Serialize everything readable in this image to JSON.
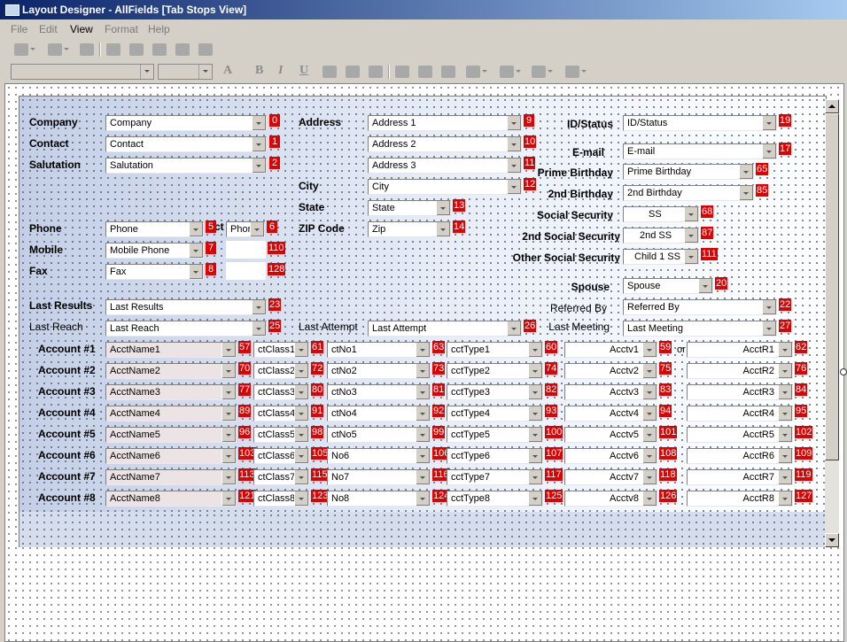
{
  "window": {
    "title": "Layout Designer - AllFields [Tab Stops View]"
  },
  "menu": [
    "File",
    "Edit",
    "View",
    "Format",
    "Help"
  ],
  "labels": {
    "company": "Company",
    "contact": "Contact",
    "salutation": "Salutation",
    "phone": "Phone",
    "phone_ext": "ct",
    "mobile": "Mobile",
    "fax": "Fax",
    "last_results": "Last Results",
    "last_reach": "Last Reach",
    "address": "Address",
    "city": "City",
    "state": "State",
    "zip": "ZIP Code",
    "last_attempt": "Last Attempt",
    "id_status": "ID/Status",
    "email": "E-mail",
    "prime_birthday": "Prime Birthday",
    "second_birthday": "2nd Birthday",
    "ssn": "Social Security",
    "second_ssn": "2nd Social Security",
    "other_ssn": "Other Social Security",
    "spouse": "Spouse",
    "referred_by": "Referred By",
    "last_meeting": "Last Meeting",
    "acct_or": "or"
  },
  "fields": {
    "company": {
      "value": "Company",
      "tab": "0"
    },
    "contact": {
      "value": "Contact",
      "tab": "1"
    },
    "salutation": {
      "value": "Salutation",
      "tab": "2"
    },
    "phone": {
      "value": "Phone",
      "tab": "5"
    },
    "phone_ext": {
      "value": "Phor",
      "tab": "6"
    },
    "mobile": {
      "value": "Mobile Phone",
      "tab": "7"
    },
    "mobile_ext": {
      "tab": "110"
    },
    "fax": {
      "value": "Fax",
      "tab": "8"
    },
    "fax_ext": {
      "tab": "128"
    },
    "last_results": {
      "value": "Last Results",
      "tab": "23"
    },
    "last_reach": {
      "value": "Last Reach",
      "tab": "25"
    },
    "address1": {
      "value": "Address 1",
      "tab": "9"
    },
    "address2": {
      "value": "Address 2",
      "tab": "10"
    },
    "address3": {
      "value": "Address 3",
      "tab": "11"
    },
    "city": {
      "value": "City",
      "tab": "12"
    },
    "state": {
      "value": "State",
      "tab": "13"
    },
    "zip": {
      "value": "Zip",
      "tab": "14"
    },
    "last_attempt": {
      "value": "Last Attempt",
      "tab": "26"
    },
    "id_status": {
      "value": "ID/Status",
      "tab": "19"
    },
    "email": {
      "value": "E-mail",
      "tab": "17"
    },
    "prime_birthday": {
      "value": "Prime Birthday",
      "tab": "65"
    },
    "second_birthday": {
      "value": "2nd Birthday",
      "tab": "85"
    },
    "ssn": {
      "value": "SS",
      "tab": "68"
    },
    "second_ssn": {
      "value": "2nd SS",
      "tab": "87"
    },
    "other_ssn": {
      "value": "Child 1 SS",
      "tab": "111"
    },
    "spouse": {
      "value": "Spouse",
      "tab": "20"
    },
    "referred_by": {
      "value": "Referred By",
      "tab": "22"
    },
    "last_meeting": {
      "value": "Last Meeting",
      "tab": "27"
    }
  },
  "accounts": [
    {
      "label": "Account #1",
      "name": "AcctName1",
      "t1": "57",
      "class": "ctClass1",
      "t2": "61",
      "no": "ctNo1",
      "t3": "63",
      "type": "cctType1",
      "t4": "60",
      "v": "Acctv1",
      "t5": "59",
      "r": "AcctR1",
      "t6": "62"
    },
    {
      "label": "Account #2",
      "name": "AcctName2",
      "t1": "70",
      "class": "ctClass2",
      "t2": "72",
      "no": "ctNo2",
      "t3": "73",
      "type": "cctType2",
      "t4": "74",
      "v": "Acctv2",
      "t5": "75",
      "r": "AcctR2",
      "t6": "76"
    },
    {
      "label": "Account #3",
      "name": "AcctName3",
      "t1": "77",
      "class": "ctClass3",
      "t2": "80",
      "no": "ctNo3",
      "t3": "81",
      "type": "cctType3",
      "t4": "82",
      "v": "Acctv3",
      "t5": "83",
      "r": "AcctR3",
      "t6": "84"
    },
    {
      "label": "Account #4",
      "name": "AcctName4",
      "t1": "89",
      "class": "ctClass4",
      "t2": "91",
      "no": "ctNo4",
      "t3": "92",
      "type": "cctType4",
      "t4": "93",
      "v": "Acctv4",
      "t5": "94",
      "r": "AcctR4",
      "t6": "95"
    },
    {
      "label": "Account #5",
      "name": "AcctName5",
      "t1": "96",
      "class": "ctClass5",
      "t2": "98",
      "no": "ctNo5",
      "t3": "99",
      "type": "cctType5",
      "t4": "100",
      "v": "Acctv5",
      "t5": "101",
      "r": "AcctR5",
      "t6": "102"
    },
    {
      "label": "Account #6",
      "name": "AcctName6",
      "t1": "103",
      "class": "ctClass6",
      "t2": "105",
      "no": "No6",
      "t3": "106",
      "type": "cctType6",
      "t4": "107",
      "v": "Acctv6",
      "t5": "108",
      "r": "AcctR6",
      "t6": "109"
    },
    {
      "label": "Account #7",
      "name": "AcctName7",
      "t1": "113",
      "class": "ctClass7",
      "t2": "115",
      "no": "No7",
      "t3": "116",
      "type": "cctType7",
      "t4": "117",
      "v": "Acctv7",
      "t5": "118",
      "r": "AcctR7",
      "t6": "119"
    },
    {
      "label": "Account #8",
      "name": "AcctName8",
      "t1": "121",
      "class": "ctClass8",
      "t2": "123",
      "no": "No8",
      "t3": "124",
      "type": "cctType8",
      "t4": "125",
      "v": "Acctv8",
      "t5": "126",
      "r": "AcctR8",
      "t6": "127"
    }
  ]
}
